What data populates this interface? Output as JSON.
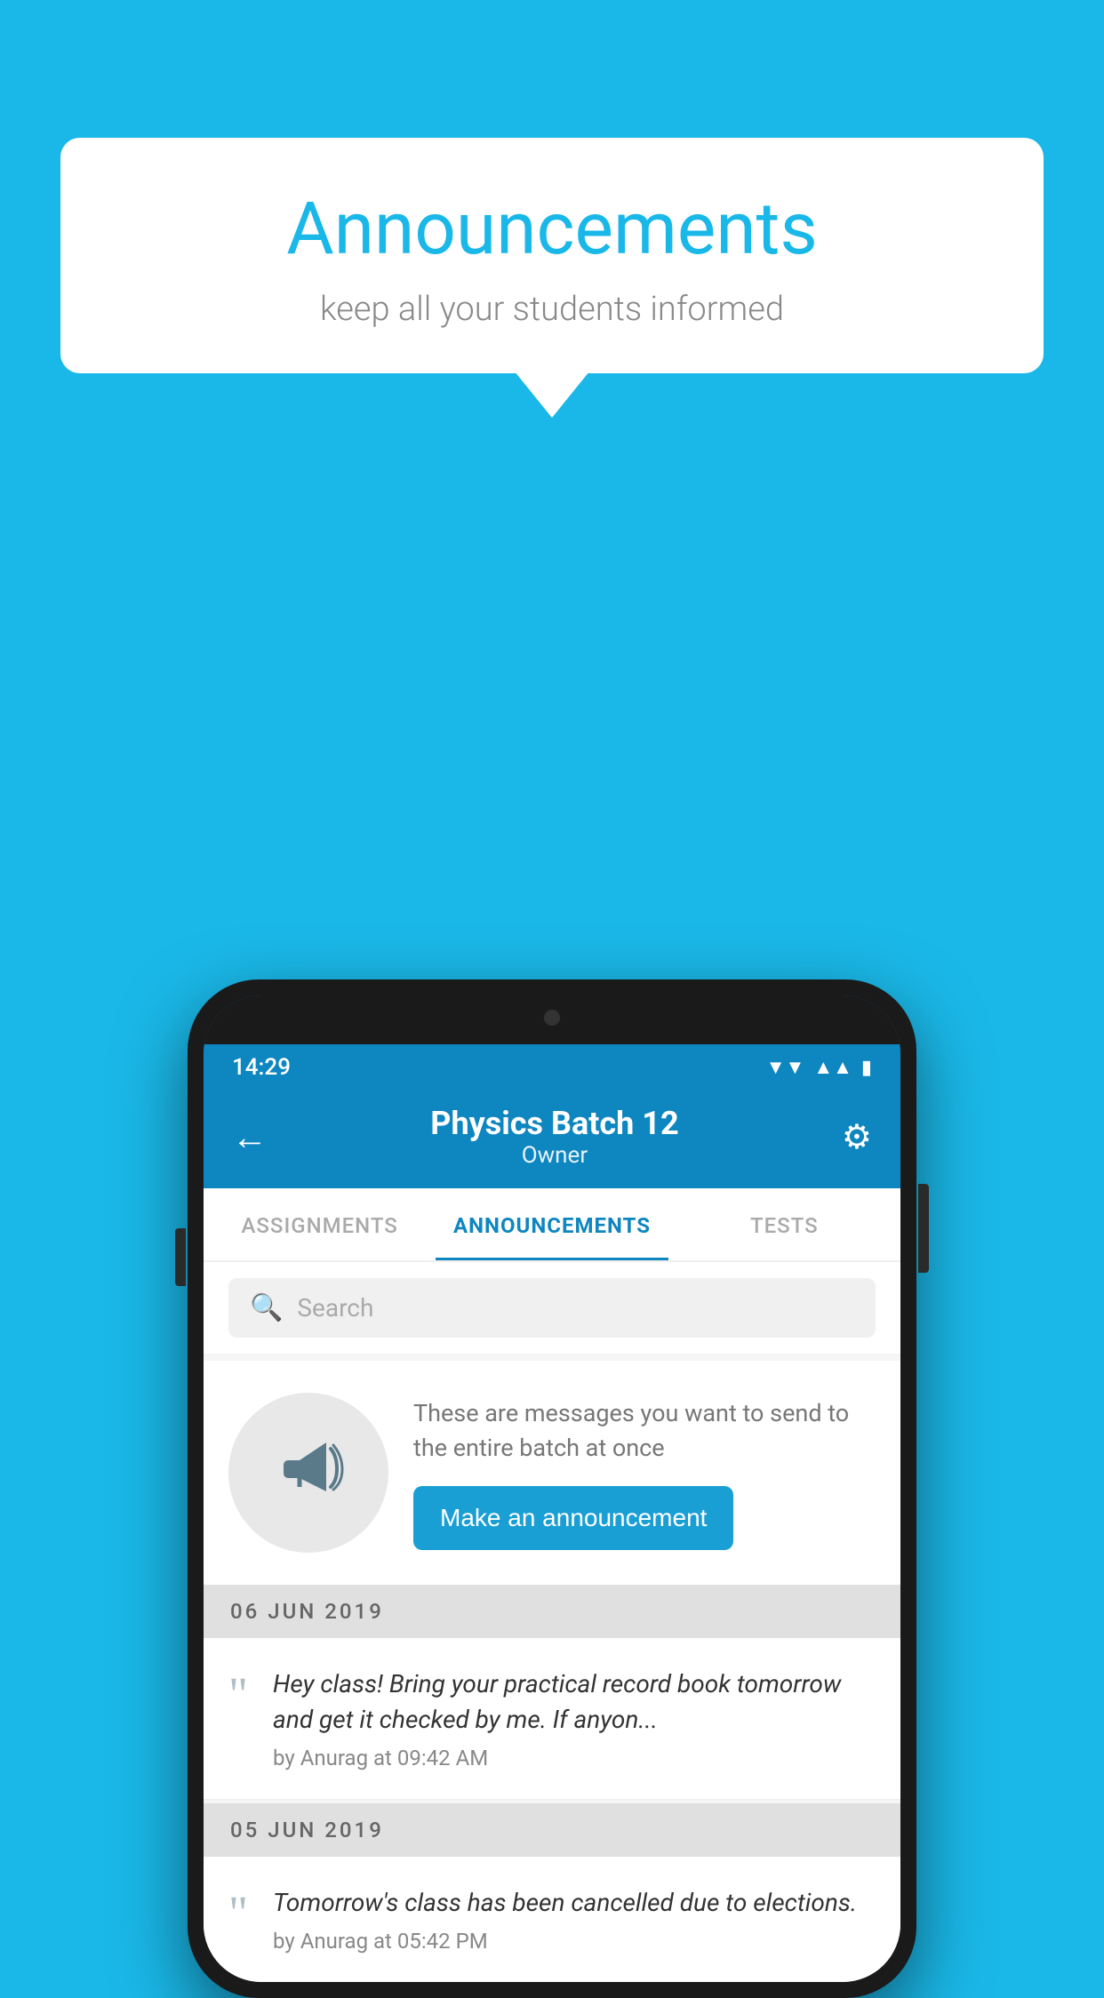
{
  "page": {
    "background_color": "#1ab8e8"
  },
  "speech_bubble": {
    "title": "Announcements",
    "subtitle": "keep all your students informed"
  },
  "phone": {
    "status_bar": {
      "time": "14:29",
      "wifi": "▾",
      "signal": "▴",
      "battery": "▮"
    },
    "header": {
      "title": "Physics Batch 12",
      "subtitle": "Owner",
      "back_label": "←",
      "settings_label": "⚙"
    },
    "tabs": [
      {
        "label": "ASSIGNMENTS",
        "active": false
      },
      {
        "label": "ANNOUNCEMENTS",
        "active": true
      },
      {
        "label": "TESTS",
        "active": false
      }
    ],
    "search": {
      "placeholder": "Search"
    },
    "promo": {
      "description": "These are messages you want to send to the entire batch at once",
      "button_label": "Make an announcement"
    },
    "announcements": [
      {
        "date": "06  JUN  2019",
        "text": "Hey class! Bring your practical record book tomorrow and get it checked by me. If anyon...",
        "meta": "by Anurag at 09:42 AM"
      },
      {
        "date": "05  JUN  2019",
        "text": "Tomorrow's class has been cancelled due to elections.",
        "meta": "by Anurag at 05:42 PM"
      }
    ]
  }
}
